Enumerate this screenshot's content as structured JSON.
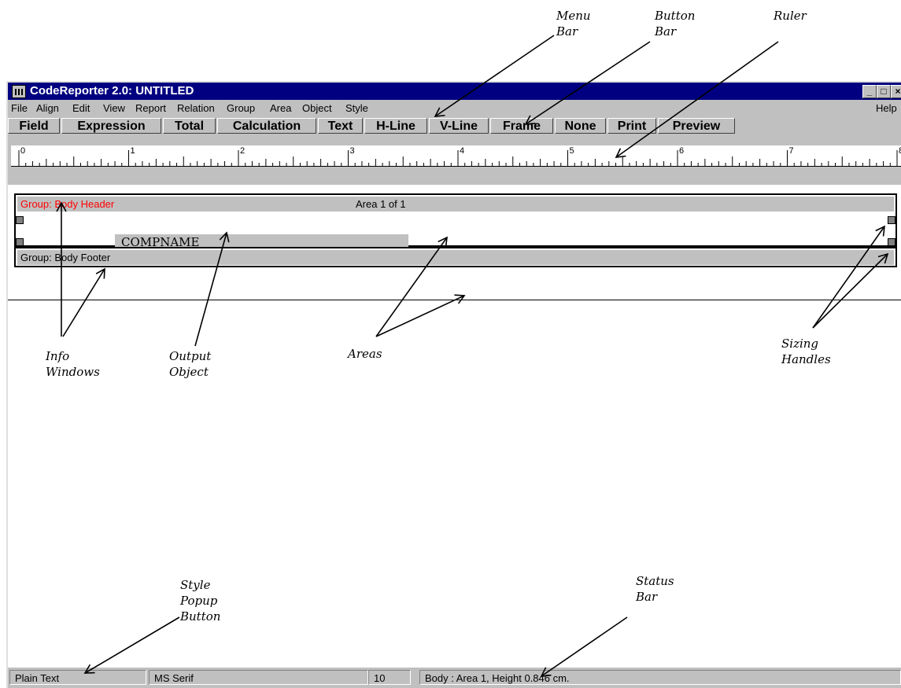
{
  "window": {
    "title": "CodeReporter 2.0: UNTITLED",
    "minimize_glyph": "_",
    "maximize_glyph": "□",
    "close_glyph": "×"
  },
  "menubar": {
    "items": [
      "File",
      "Align",
      "Edit",
      "View",
      "Report",
      "Relation",
      "Group",
      "Area",
      "Object",
      "Style"
    ],
    "help": "Help"
  },
  "buttonbar": {
    "buttons": [
      "Field",
      "Expression",
      "Total",
      "Calculation",
      "Text",
      "H-Line",
      "V-Line",
      "Frame",
      "None",
      "Print",
      "Preview"
    ]
  },
  "ruler": {
    "labels": [
      "0",
      "1",
      "2",
      "3",
      "4",
      "5",
      "6",
      "7",
      "8"
    ]
  },
  "areas": {
    "header_label": "Group: Body Header",
    "area_count": "Area 1 of 1",
    "output_object": "COMPNAME",
    "footer_label": "Group: Body Footer"
  },
  "statusbar": {
    "style": "Plain Text",
    "font": "MS Serif",
    "size": "10",
    "info": "Body  :  Area 1,  Height 0.846 cm."
  },
  "callouts": {
    "menu_bar": "Menu\nBar",
    "button_bar": "Button\nBar",
    "ruler": "Ruler",
    "info_windows": "Info\nWindows",
    "output_object": "Output\nObject",
    "areas": "Areas",
    "sizing_handles": "Sizing\nHandles",
    "style_popup": "Style\nPopup\nButton",
    "status_bar": "Status\nBar"
  },
  "colors": {
    "title_bar": "#000080",
    "chrome": "#c0c0c0",
    "header_label": "#ff0000"
  },
  "icons": {
    "app": "report-grid-icon"
  }
}
